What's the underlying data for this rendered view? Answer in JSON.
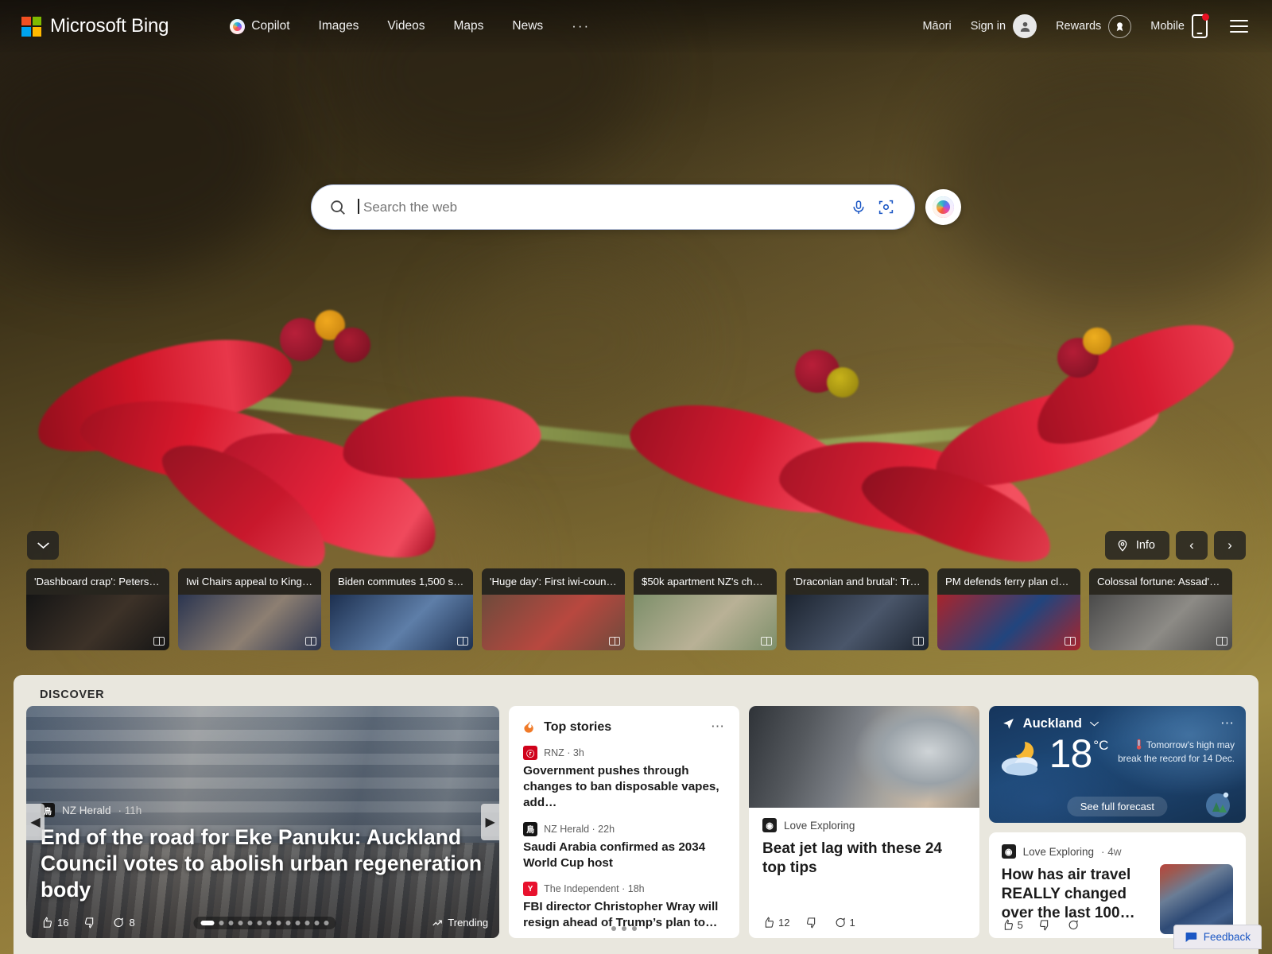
{
  "header": {
    "logo_text": "Microsoft Bing",
    "logo_icon": "microsoft-squares-icon",
    "nav": [
      {
        "label": "Copilot",
        "icon": "copilot-icon"
      },
      {
        "label": "Images",
        "icon": ""
      },
      {
        "label": "Videos",
        "icon": ""
      },
      {
        "label": "Maps",
        "icon": ""
      },
      {
        "label": "News",
        "icon": ""
      },
      {
        "label": "···",
        "icon": "more-icon"
      }
    ],
    "language": "Māori",
    "sign_in": "Sign in",
    "rewards": "Rewards",
    "mobile": "Mobile"
  },
  "search": {
    "placeholder": "Search the web",
    "mic_icon": "microphone-icon",
    "lens_icon": "visual-search-icon",
    "copilot_icon": "copilot-icon"
  },
  "image_controls": {
    "info_label": "Info",
    "info_icon": "location-pin-icon",
    "prev": "‹",
    "next": "›",
    "scroll_down_icon": "chevron-down-icon"
  },
  "news_strip": [
    {
      "title": "'Dashboard crap': Peters s…",
      "color_a": "#151515",
      "color_b": "#3d3228"
    },
    {
      "title": "Iwi Chairs appeal to King …",
      "color_a": "#2b3550",
      "color_b": "#8d7f72"
    },
    {
      "title": "Biden commutes 1,500 se…",
      "color_a": "#1d3050",
      "color_b": "#5e7ea8"
    },
    {
      "title": "'Huge day': First iwi-counc…",
      "color_a": "#6e4a3c",
      "color_b": "#b8483f"
    },
    {
      "title": "$50k apartment NZ's chea…",
      "color_a": "#7d8f6a",
      "color_b": "#b9b196"
    },
    {
      "title": "'Draconian and brutal': Tru…",
      "color_a": "#1c2430",
      "color_b": "#4a566a"
    },
    {
      "title": "PM defends ferry plan clai…",
      "color_a": "#a8242c",
      "color_b": "#21457e"
    },
    {
      "title": "Colossal fortune: Assad's …",
      "color_a": "#4a4a4a",
      "color_b": "#8d8b86"
    }
  ],
  "discover": {
    "label": "DISCOVER",
    "hero": {
      "source": "NZ Herald",
      "source_initials": "鳥",
      "source_color": "#141414",
      "time": "11h",
      "title": "End of the road for Eke Panuku: Auckland Council votes to abolish urban regeneration body",
      "likes": "16",
      "comments": "8",
      "trending": "Trending",
      "trending_icon": "trending-up-icon",
      "like_icon": "thumbs-up-icon",
      "dislike_icon": "thumbs-down-icon",
      "comment_icon": "comment-icon",
      "dots_total": 13,
      "dots_active": 0
    },
    "top_stories": {
      "title": "Top stories",
      "icon": "fire-icon",
      "menu_icon": "more-options-icon",
      "items": [
        {
          "source": "RNZ",
          "source_initials": "ⓡ",
          "source_color": "#d0021b",
          "time": "3h",
          "headline": "Government pushes through changes to ban disposable vapes, add…"
        },
        {
          "source": "NZ Herald",
          "source_initials": "鳥",
          "source_color": "#141414",
          "time": "22h",
          "headline": "Saudi Arabia confirmed as 2034 World Cup host"
        },
        {
          "source": "The Independent",
          "source_initials": "Y",
          "source_color": "#e8112d",
          "time": "18h",
          "headline": "FBI director Christopher Wray will resign ahead of Trump’s plan to…"
        }
      ],
      "dots": 3
    },
    "jetlag": {
      "source": "Love Exploring",
      "source_initials": "◉",
      "source_color": "#1d1d1d",
      "title": "Beat jet lag with these 24 top tips",
      "likes": "12",
      "comments": "1"
    },
    "weather": {
      "city": "Auckland",
      "location_icon": "navigation-arrow-icon",
      "chevron_icon": "chevron-down-icon",
      "menu_icon": "more-options-icon",
      "condition_icon": "moon-cloud-icon",
      "temperature": "18",
      "unit": "°C",
      "note": "Tomorrow's high may break the record for 14 Dec.",
      "note_icon": "thermometer-icon",
      "forecast_label": "See full forecast"
    },
    "airtravel": {
      "source": "Love Exploring",
      "source_initials": "◉",
      "source_color": "#1d1d1d",
      "time": "4w",
      "title": "How has air travel REALLY changed over the last 100…",
      "likes": "5"
    }
  },
  "feedback": {
    "label": "Feedback",
    "icon": "feedback-icon"
  },
  "colors": {
    "accent_blue": "#1a56c4",
    "bing_red": "#e81123",
    "discover_bg": "#e9e7de"
  }
}
